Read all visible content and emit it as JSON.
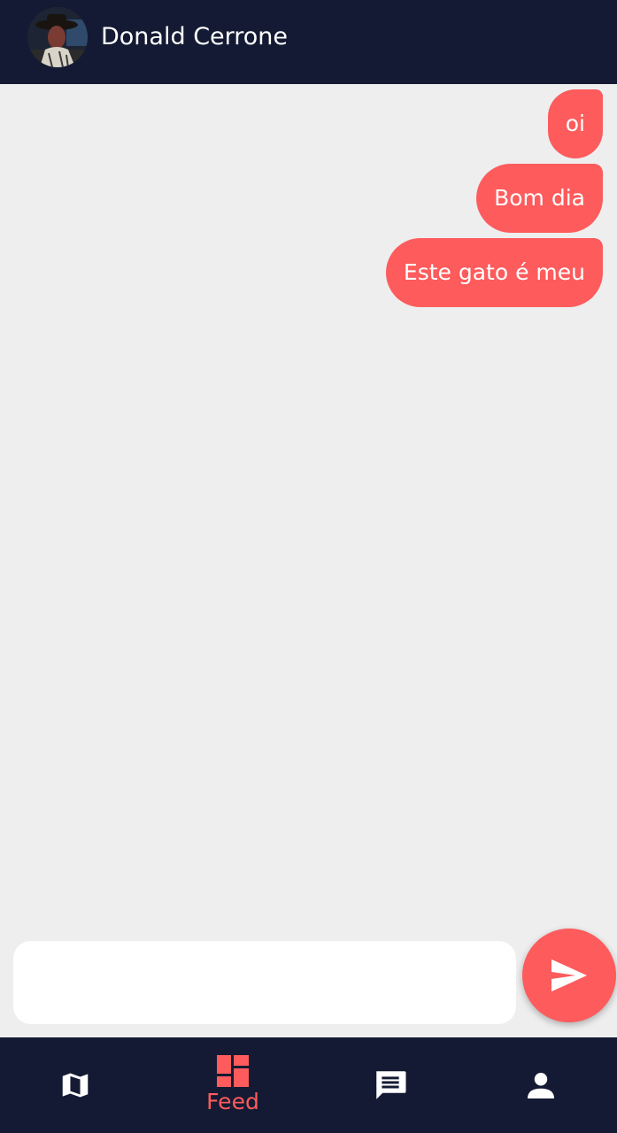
{
  "colors": {
    "header_bg": "#141a33",
    "chat_bg": "#eeeeee",
    "accent": "#fd5b5c",
    "text_light": "#ffffff"
  },
  "header": {
    "contact_name": "Donald Cerrone",
    "avatar_icon": "user-avatar-photo"
  },
  "messages": [
    {
      "text": "oi",
      "from": "me"
    },
    {
      "text": "Bom dia",
      "from": "me"
    },
    {
      "text": "Este gato é meu",
      "from": "me"
    }
  ],
  "composer": {
    "value": "",
    "placeholder": ""
  },
  "send_button": {
    "icon": "send-icon"
  },
  "bottom_nav": {
    "items": [
      {
        "icon": "map-icon",
        "label": "",
        "active": false
      },
      {
        "icon": "feed-icon",
        "label": "Feed",
        "active": true
      },
      {
        "icon": "chat-icon",
        "label": "",
        "active": false
      },
      {
        "icon": "person-icon",
        "label": "",
        "active": false
      }
    ]
  }
}
